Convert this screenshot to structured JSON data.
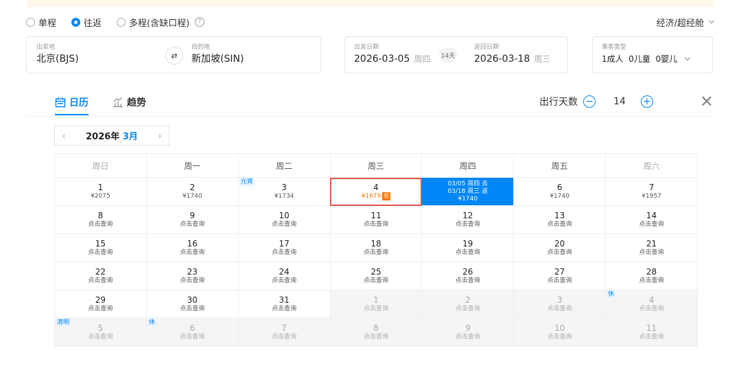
{
  "trip_types": [
    {
      "label": "单程",
      "selected": false
    },
    {
      "label": "往返",
      "selected": true
    },
    {
      "label": "多程(含缺口程)",
      "selected": false
    }
  ],
  "help_icon": "?",
  "cabin": "经济/超经舱",
  "departure": {
    "label": "出发地",
    "value": "北京(BJS)"
  },
  "arrival": {
    "label": "目的地",
    "value": "新加坡(SIN)"
  },
  "swap_icon": "⇄",
  "depart_date": {
    "label": "出发日期",
    "date": "2026-03-05",
    "weekday": "周四"
  },
  "trip_days_badge": "14天",
  "return_date": {
    "label": "返回日期",
    "date": "2026-03-18",
    "weekday": "周三"
  },
  "passengers": {
    "label": "乘客类型",
    "value": "1成人  0儿童  0婴儿"
  },
  "tabs": [
    {
      "label": "日历",
      "active": true,
      "icon": "calendar-icon"
    },
    {
      "label": "趋势",
      "active": false,
      "icon": "trend-icon"
    }
  ],
  "trip_days": {
    "label": "出行天数",
    "value": "14",
    "minus": "−",
    "plus": "+"
  },
  "close": "✕",
  "month_nav": {
    "prev": "‹",
    "year": "2026年",
    "month": "3月",
    "next": "›"
  },
  "weekdays": [
    "周日",
    "周一",
    "周二",
    "周三",
    "周四",
    "周五",
    "周六"
  ],
  "accent_color": "#0086f6",
  "low_price_color": "#ff7700",
  "weeks": [
    [
      {
        "day": "1",
        "price": "¥2075"
      },
      {
        "day": "2",
        "price": "¥1740"
      },
      {
        "day": "3",
        "price": "¥1734",
        "tag": "元宵"
      },
      {
        "day": "4",
        "price": "¥1679",
        "low": "低"
      },
      {
        "selected": true,
        "lines": [
          "03/05 周四 去",
          "03/18 周三 返",
          "¥1740"
        ]
      },
      {
        "day": "6",
        "price": "¥1740"
      },
      {
        "day": "7",
        "price": "¥1957"
      }
    ],
    [
      {
        "day": "8",
        "price": "点击查询"
      },
      {
        "day": "9",
        "price": "点击查询"
      },
      {
        "day": "10",
        "price": "点击查询"
      },
      {
        "day": "11",
        "price": "点击查询"
      },
      {
        "day": "12",
        "price": "点击查询"
      },
      {
        "day": "13",
        "price": "点击查询"
      },
      {
        "day": "14",
        "price": "点击查询"
      }
    ],
    [
      {
        "day": "15",
        "price": "点击查询"
      },
      {
        "day": "16",
        "price": "点击查询"
      },
      {
        "day": "17",
        "price": "点击查询"
      },
      {
        "day": "18",
        "price": "点击查询"
      },
      {
        "day": "19",
        "price": "点击查询"
      },
      {
        "day": "20",
        "price": "点击查询"
      },
      {
        "day": "21",
        "price": "点击查询"
      }
    ],
    [
      {
        "day": "22",
        "price": "点击查询"
      },
      {
        "day": "23",
        "price": "点击查询"
      },
      {
        "day": "24",
        "price": "点击查询"
      },
      {
        "day": "25",
        "price": "点击查询"
      },
      {
        "day": "26",
        "price": "点击查询"
      },
      {
        "day": "27",
        "price": "点击查询"
      },
      {
        "day": "28",
        "price": "点击查询"
      }
    ],
    [
      {
        "day": "29",
        "price": "点击查询"
      },
      {
        "day": "30",
        "price": "点击查询"
      },
      {
        "day": "31",
        "price": "点击查询"
      },
      {
        "day": "1",
        "price": "点击查询",
        "other": true
      },
      {
        "day": "2",
        "price": "点击查询",
        "other": true
      },
      {
        "day": "3",
        "price": "点击查询",
        "other": true
      },
      {
        "day": "4",
        "price": "点击查询",
        "other": true,
        "tag": "休"
      }
    ],
    [
      {
        "day": "5",
        "price": "点击查询",
        "other": true,
        "tag": "清明"
      },
      {
        "day": "6",
        "price": "点击查询",
        "other": true,
        "tag": "休"
      },
      {
        "day": "7",
        "price": "点击查询",
        "other": true
      },
      {
        "day": "8",
        "price": "点击查询",
        "other": true
      },
      {
        "day": "9",
        "price": "点击查询",
        "other": true
      },
      {
        "day": "10",
        "price": "点击查询",
        "other": true
      },
      {
        "day": "11",
        "price": "点击查询",
        "other": true
      }
    ]
  ]
}
